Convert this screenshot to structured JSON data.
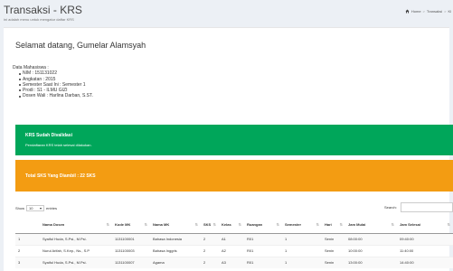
{
  "header": {
    "title": "Transaksi - KRS",
    "subtitle": "ini adalah menu untuk mengatur daftar KRS",
    "breadcrumb": [
      "Home",
      "Transaksi",
      "Kl"
    ]
  },
  "welcome": {
    "title": "Selamat datang, Gumelar Alamsyah"
  },
  "mahasiswa": {
    "heading": "Data Mahasiswa :",
    "items": [
      "NIM : 151131022",
      "Angkatan : 2015",
      "Semester Saat Ini : Semester 1",
      "Prodi : S1 - ILMU GIZI",
      "Dosen Wali : Harlina Darban, S.ST."
    ]
  },
  "alert_validasi": {
    "title": "KRS Sudah Divalidasi",
    "text": "Pendaftaran KRS telah selesai dilakukan."
  },
  "alert_sks": {
    "title": "Total SKS Yang Diambil : 22 SKS"
  },
  "datatable": {
    "show_label": "Show",
    "length_value": "10",
    "entries_label": "entries",
    "search_label": "Search:"
  },
  "table": {
    "headers": [
      "",
      "Nama Dosen",
      "Kode MK",
      "Nama MK",
      "SKS",
      "Kelas",
      "Ruangan",
      "Semester",
      "Hari",
      "Jam Mulai",
      "Jam Selesai"
    ],
    "rows": [
      [
        "1",
        "Syaiful Huda, S.Psi., M.Psi.",
        "1131100001",
        "Bahasa Indonesia",
        "2",
        "A1",
        "R01",
        "1",
        "Senin",
        "08:00:00",
        "09:40:00"
      ],
      [
        "2",
        "Nurul Arifah, S.Kep., Ns., S.P",
        "1131100003",
        "Bahasa Inggris",
        "2",
        "A2",
        "R01",
        "1",
        "Senin",
        "10:00:00",
        "11:40:00"
      ],
      [
        "3",
        "Syaiful Huda, S.Psi., M.Psi.",
        "1131100007",
        "Agama",
        "2",
        "A3",
        "R01",
        "1",
        "Senin",
        "13:00:00",
        "14:40:00"
      ]
    ]
  },
  "colors": {
    "success": "#00a65a",
    "warning": "#f39c12"
  }
}
